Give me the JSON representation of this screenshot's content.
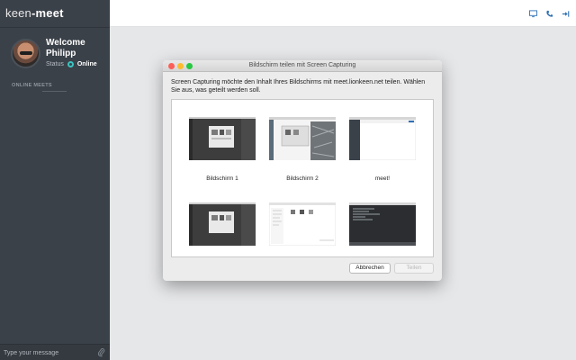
{
  "sidebar": {
    "logo_light": "keen",
    "logo_bold": "-meet",
    "welcome_line1": "Welcome",
    "welcome_line2": "Philipp",
    "status_label": "Status",
    "status_value": "Online",
    "online_meets_label": "ONLINE MEETS",
    "message_placeholder": "Type your message",
    "icons": {
      "attach": "paperclip-icon"
    }
  },
  "topbar": {
    "icons": [
      "screen-share-icon",
      "phone-icon",
      "logout-icon"
    ]
  },
  "dialog": {
    "title": "Bildschirm teilen mit Screen Capturing",
    "description": "Screen Capturing möchte den Inhalt Ihres Bildschirms mit meet.lionkeen.net teilen. Wählen Sie aus, was geteilt werden soll.",
    "sources": [
      {
        "label": "Bildschirm 1"
      },
      {
        "label": "Bildschirm 2"
      },
      {
        "label": "meet!"
      },
      {
        "label": ""
      },
      {
        "label": ""
      },
      {
        "label": ""
      }
    ],
    "cancel_label": "Abbrechen",
    "share_label": "Teilen"
  },
  "colors": {
    "sidebar_bg": "#3b4149",
    "accent_teal": "#3cc3c0",
    "topbar_icon_blue": "#2f6fb5",
    "traffic_red": "#fc5f57",
    "traffic_yellow": "#fdbc2e",
    "traffic_green": "#28c840"
  }
}
